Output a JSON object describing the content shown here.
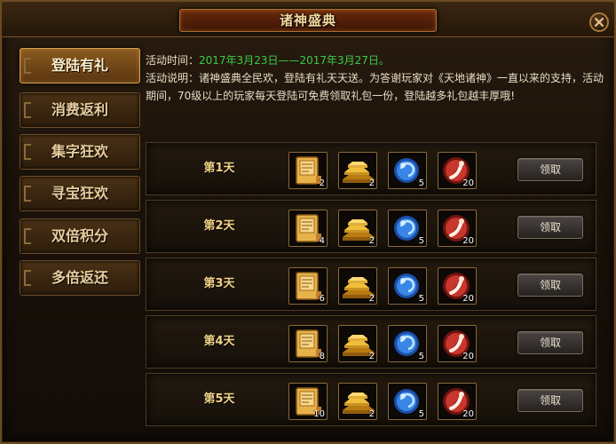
{
  "window": {
    "title": "诸神盛典"
  },
  "sidebar": {
    "items": [
      {
        "label": "登陆有礼",
        "active": true
      },
      {
        "label": "消费返利",
        "active": false
      },
      {
        "label": "集字狂欢",
        "active": false
      },
      {
        "label": "寻宝狂欢",
        "active": false
      },
      {
        "label": "双倍积分",
        "active": false
      },
      {
        "label": "多倍返还",
        "active": false
      }
    ]
  },
  "info": {
    "time_label": "活动时间：",
    "time_value": "2017年3月23日——2017年3月27日。",
    "desc_label": "活动说明：",
    "desc_line1": "诸神盛典全民欢，登陆有礼天天送。为答谢玩家对《天地诸神》一直以来的支持，活动",
    "desc_line2": "期间，70级以上的玩家每天登陆可免费领取礼包一份，登陆越多礼包越丰厚哦!"
  },
  "days": [
    {
      "label": "第1天",
      "rewards": [
        {
          "icon": "scroll-icon",
          "count": "2"
        },
        {
          "icon": "gold-bars-icon",
          "count": "2"
        },
        {
          "icon": "blue-orb-icon",
          "count": "5"
        },
        {
          "icon": "red-orb-icon",
          "count": "20"
        }
      ],
      "button": "领取"
    },
    {
      "label": "第2天",
      "rewards": [
        {
          "icon": "scroll-icon",
          "count": "4"
        },
        {
          "icon": "gold-bars-icon",
          "count": "2"
        },
        {
          "icon": "blue-orb-icon",
          "count": "5"
        },
        {
          "icon": "red-orb-icon",
          "count": "20"
        }
      ],
      "button": "领取"
    },
    {
      "label": "第3天",
      "rewards": [
        {
          "icon": "scroll-icon",
          "count": "6"
        },
        {
          "icon": "gold-bars-icon",
          "count": "2"
        },
        {
          "icon": "blue-orb-icon",
          "count": "5"
        },
        {
          "icon": "red-orb-icon",
          "count": "20"
        }
      ],
      "button": "领取"
    },
    {
      "label": "第4天",
      "rewards": [
        {
          "icon": "scroll-icon",
          "count": "8"
        },
        {
          "icon": "gold-bars-icon",
          "count": "2"
        },
        {
          "icon": "blue-orb-icon",
          "count": "5"
        },
        {
          "icon": "red-orb-icon",
          "count": "20"
        }
      ],
      "button": "领取"
    },
    {
      "label": "第5天",
      "rewards": [
        {
          "icon": "scroll-icon",
          "count": "10"
        },
        {
          "icon": "gold-bars-icon",
          "count": "2"
        },
        {
          "icon": "blue-orb-icon",
          "count": "5"
        },
        {
          "icon": "red-orb-icon",
          "count": "20"
        }
      ],
      "button": "领取"
    }
  ],
  "colors": {
    "accent_gold": "#f2d388",
    "time_green": "#3ccc44",
    "frame_border": "#6a4a22"
  }
}
